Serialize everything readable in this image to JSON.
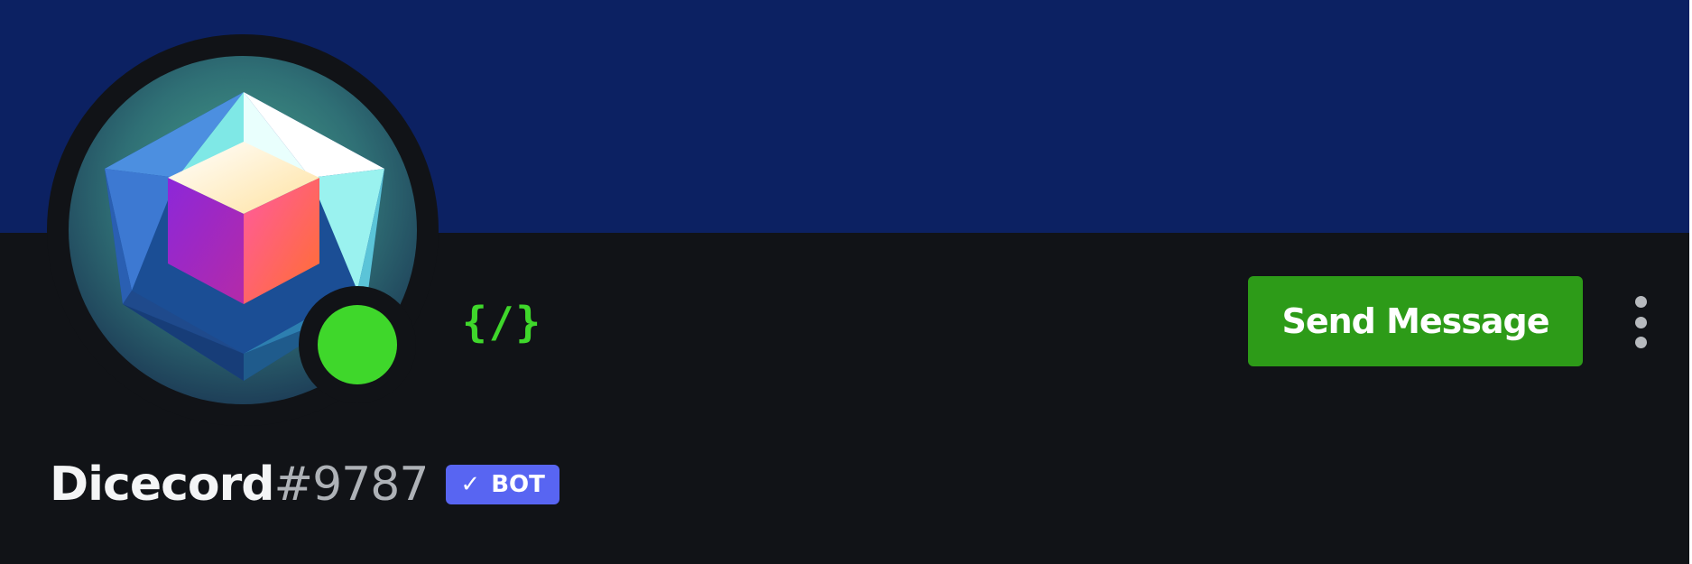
{
  "profile": {
    "username": "Dicecord",
    "discriminator": "#9787",
    "bot_tag": {
      "check_icon": "✓",
      "label": "BOT"
    },
    "status": "online",
    "slash_commands_badge": "{/}",
    "avatar_icon": "dice-cube-avatar"
  },
  "actions": {
    "send_message_label": "Send Message",
    "more_icon": "vertical-ellipsis-icon"
  },
  "colors": {
    "banner": "#0c2162",
    "background": "#111317",
    "online": "#3fd72b",
    "send_button": "#2d9b18",
    "bot_tag": "#5865f2"
  }
}
